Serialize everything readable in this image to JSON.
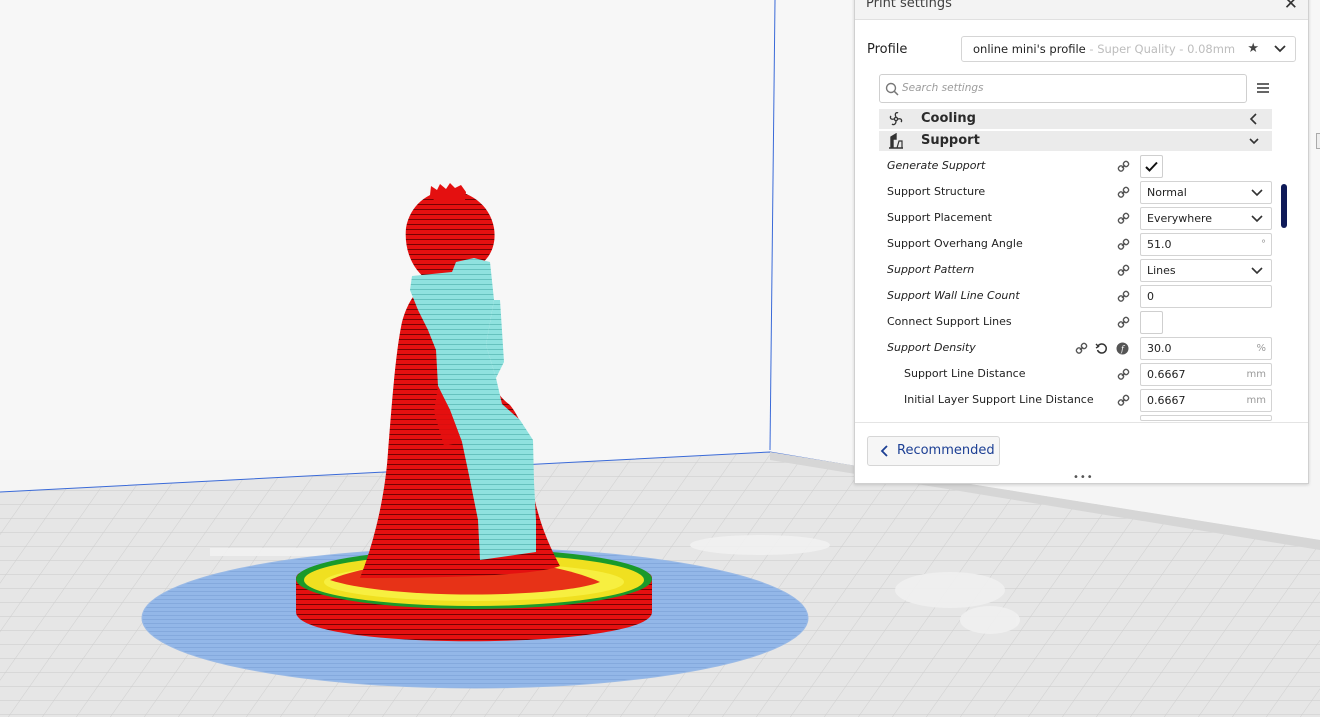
{
  "panel": {
    "title": "Print settings",
    "close_glyph": "✕",
    "profile_label": "Profile",
    "profile_name": "online mini's profile",
    "profile_quality": " - Super Quality - 0.08mm",
    "search_placeholder": "Search settings",
    "categories": [
      {
        "label": "Cooling",
        "icon": "fan-icon",
        "state": "collapsed"
      },
      {
        "label": "Support",
        "icon": "support-icon",
        "state": "expanded"
      }
    ],
    "settings": [
      {
        "label": "Generate Support",
        "type": "checkbox",
        "checked": true
      },
      {
        "label": "Support Structure",
        "type": "dropdown",
        "value": "Normal"
      },
      {
        "label": "Support Placement",
        "type": "dropdown",
        "value": "Everywhere"
      },
      {
        "label": "Support Overhang Angle",
        "type": "number",
        "value": "51.0",
        "unit": "°"
      },
      {
        "label": "Support Pattern",
        "type": "dropdown",
        "value": "Lines"
      },
      {
        "label": "Support Wall Line Count",
        "type": "number",
        "value": "0",
        "unit": ""
      },
      {
        "label": "Connect Support Lines",
        "type": "checkbox",
        "checked": false
      },
      {
        "label": "Support Density",
        "type": "number",
        "value": "30.0",
        "unit": "%"
      },
      {
        "label": "Support Line Distance",
        "type": "number",
        "value": "0.6667",
        "unit": "mm"
      },
      {
        "label": "Initial Layer Support Line Distance",
        "type": "number",
        "value": "0.6667",
        "unit": "mm"
      }
    ],
    "recommended_label": "Recommended",
    "drag_handle": "•••"
  },
  "colors": {
    "accent": "#1c3f94",
    "scrollbar": "#0f1a58",
    "model_red": "#e01010",
    "support_cyan": "#88e0de",
    "skirt_blue": "#8fb4e6",
    "top_yellow": "#f0e020",
    "build_plate": "#e4e4e4"
  }
}
